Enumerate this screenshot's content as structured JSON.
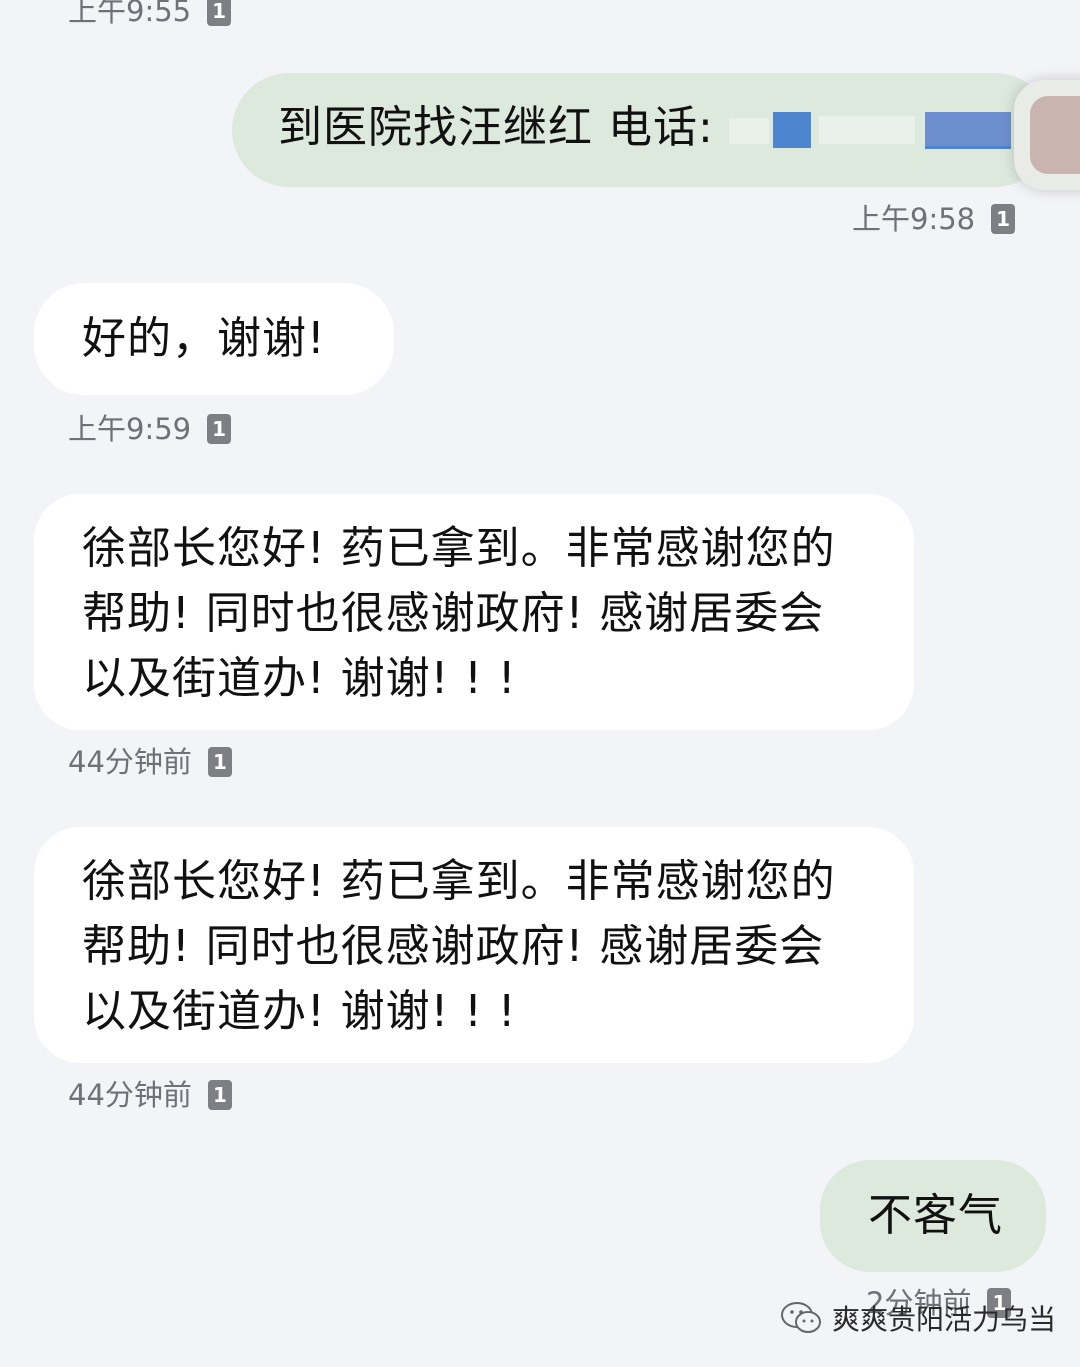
{
  "messages": [
    {
      "meta": {
        "time": "上午9:55",
        "sim": "1"
      }
    },
    {
      "text": "到医院找汪继红 电话:",
      "meta": {
        "time": "上午9:58",
        "sim": "1"
      }
    },
    {
      "text": "好的，谢谢!",
      "meta": {
        "time": "上午9:59",
        "sim": "1"
      }
    },
    {
      "lines": [
        "徐部长您好! 药已拿到。非常感谢您的",
        "帮助! 同时也很感谢政府! 感谢居委会",
        "以及街道办! 谢谢! ! !"
      ],
      "meta": {
        "time": "44分钟前",
        "sim": "1"
      }
    },
    {
      "lines": [
        "徐部长您好! 药已拿到。非常感谢您的",
        "帮助! 同时也很感谢政府! 感谢居委会",
        "以及街道办! 谢谢! ! !"
      ],
      "meta": {
        "time": "44分钟前",
        "sim": "1"
      }
    },
    {
      "text": "不客气",
      "meta": {
        "time": "2分钟前",
        "sim": "1"
      }
    }
  ],
  "watermark": {
    "text": "爽爽贵阳活力乌当"
  },
  "colors": {
    "background": "#f3f4f8",
    "incoming_bubble": "#ffffff",
    "outgoing_bubble": "#dde9dd",
    "redaction_blue": "#4d86cf"
  }
}
